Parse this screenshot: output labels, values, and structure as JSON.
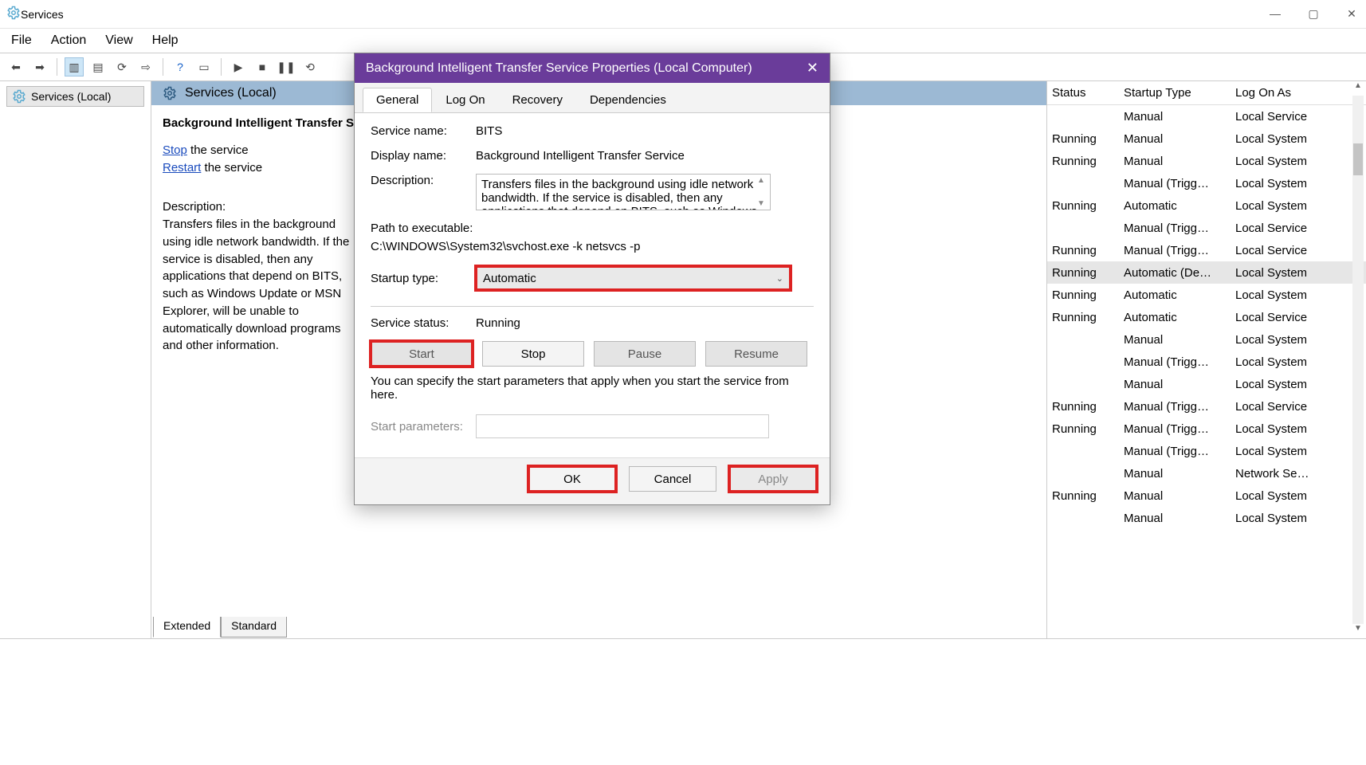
{
  "window": {
    "title": "Services",
    "minimize": "—",
    "maximize": "▢",
    "close": "✕"
  },
  "menu": {
    "file": "File",
    "action": "Action",
    "view": "View",
    "help": "Help"
  },
  "left": {
    "node": "Services (Local)"
  },
  "center": {
    "header": "Services (Local)",
    "service_name": "Background Intelligent Transfer Service",
    "stop": "Stop",
    "stop_after": " the service",
    "restart": "Restart",
    "restart_after": " the service",
    "desc_label": "Description:",
    "desc": "Transfers files in the background using idle network bandwidth. If the service is disabled, then any applications that depend on BITS, such as Windows Update or MSN Explorer, will be unable to automatically download programs and other information."
  },
  "tabs_bottom": {
    "extended": "Extended",
    "standard": "Standard"
  },
  "table": {
    "head": {
      "status": "Status",
      "startup": "Startup Type",
      "logon": "Log On As"
    },
    "rows": [
      {
        "status": "",
        "startup": "Manual",
        "logon": "Local Service"
      },
      {
        "status": "Running",
        "startup": "Manual",
        "logon": "Local System"
      },
      {
        "status": "Running",
        "startup": "Manual",
        "logon": "Local System"
      },
      {
        "status": "",
        "startup": "Manual (Trigg…",
        "logon": "Local System"
      },
      {
        "status": "Running",
        "startup": "Automatic",
        "logon": "Local System"
      },
      {
        "status": "",
        "startup": "Manual (Trigg…",
        "logon": "Local Service"
      },
      {
        "status": "Running",
        "startup": "Manual (Trigg…",
        "logon": "Local Service"
      },
      {
        "status": "Running",
        "startup": "Automatic (De…",
        "logon": "Local System",
        "sel": true
      },
      {
        "status": "Running",
        "startup": "Automatic",
        "logon": "Local System"
      },
      {
        "status": "Running",
        "startup": "Automatic",
        "logon": "Local Service"
      },
      {
        "status": "",
        "startup": "Manual",
        "logon": "Local System"
      },
      {
        "status": "",
        "startup": "Manual (Trigg…",
        "logon": "Local System"
      },
      {
        "status": "",
        "startup": "Manual",
        "logon": "Local System"
      },
      {
        "status": "Running",
        "startup": "Manual (Trigg…",
        "logon": "Local Service"
      },
      {
        "status": "Running",
        "startup": "Manual (Trigg…",
        "logon": "Local System"
      },
      {
        "status": "",
        "startup": "Manual (Trigg…",
        "logon": "Local System"
      },
      {
        "status": "",
        "startup": "Manual",
        "logon": "Network Se…"
      },
      {
        "status": "Running",
        "startup": "Manual",
        "logon": "Local System"
      },
      {
        "status": "",
        "startup": "Manual",
        "logon": "Local System"
      }
    ]
  },
  "dialog": {
    "title": "Background Intelligent Transfer Service Properties (Local Computer)",
    "tabs": {
      "general": "General",
      "logon": "Log On",
      "recovery": "Recovery",
      "deps": "Dependencies"
    },
    "service_name_label": "Service name:",
    "service_name_value": "BITS",
    "display_name_label": "Display name:",
    "display_name_value": "Background Intelligent Transfer Service",
    "description_label": "Description:",
    "description_value": "Transfers files in the background using idle network bandwidth. If the service is disabled, then any applications that depend on BITS, such as Windows",
    "path_label": "Path to executable:",
    "path_value": "C:\\WINDOWS\\System32\\svchost.exe -k netsvcs -p",
    "startup_label": "Startup type:",
    "startup_value": "Automatic",
    "status_label": "Service status:",
    "status_value": "Running",
    "btn_start": "Start",
    "btn_stop": "Stop",
    "btn_pause": "Pause",
    "btn_resume": "Resume",
    "hint": "You can specify the start parameters that apply when you start the service from here.",
    "params_label": "Start parameters:",
    "ok": "OK",
    "cancel": "Cancel",
    "apply": "Apply"
  }
}
